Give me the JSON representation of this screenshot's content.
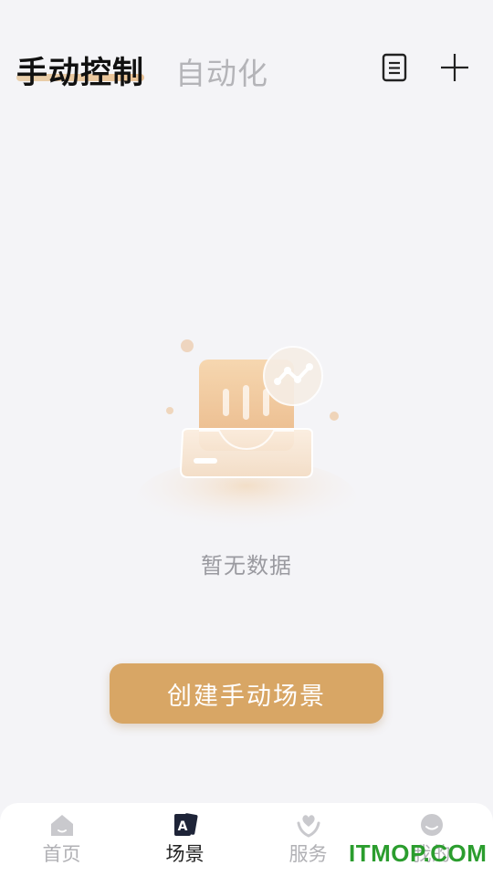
{
  "header": {
    "tabs": [
      {
        "label": "手动控制",
        "active": true
      },
      {
        "label": "自动化",
        "active": false
      }
    ],
    "icons": [
      "document-list-icon",
      "plus-icon"
    ]
  },
  "empty_state": {
    "message": "暂无数据",
    "illustration": "empty-box-icon"
  },
  "create_button": {
    "label": "创建手动场景"
  },
  "bottom_nav": {
    "items": [
      {
        "label": "首页",
        "icon": "home-icon",
        "active": false
      },
      {
        "label": "场景",
        "icon": "scene-card-icon",
        "active": true
      },
      {
        "label": "服务",
        "icon": "heart-hands-icon",
        "active": false
      },
      {
        "label": "我的",
        "icon": "profile-face-icon",
        "active": false
      }
    ]
  },
  "watermark": {
    "text": "ITMOP.COM"
  },
  "colors": {
    "background": "#f4f4f7",
    "accent": "#d8a665",
    "text_primary": "#111111",
    "text_muted": "#b4b4b8",
    "watermark": "#2b9d2e"
  }
}
